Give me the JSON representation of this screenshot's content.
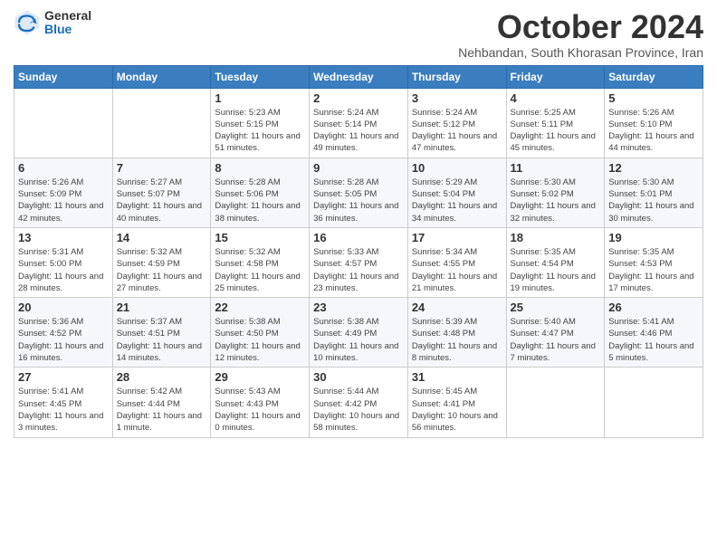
{
  "header": {
    "logo_general": "General",
    "logo_blue": "Blue",
    "month_title": "October 2024",
    "subtitle": "Nehbandan, South Khorasan Province, Iran"
  },
  "calendar": {
    "days_of_week": [
      "Sunday",
      "Monday",
      "Tuesday",
      "Wednesday",
      "Thursday",
      "Friday",
      "Saturday"
    ],
    "weeks": [
      [
        {
          "day": "",
          "info": ""
        },
        {
          "day": "",
          "info": ""
        },
        {
          "day": "1",
          "info": "Sunrise: 5:23 AM\nSunset: 5:15 PM\nDaylight: 11 hours and 51 minutes."
        },
        {
          "day": "2",
          "info": "Sunrise: 5:24 AM\nSunset: 5:14 PM\nDaylight: 11 hours and 49 minutes."
        },
        {
          "day": "3",
          "info": "Sunrise: 5:24 AM\nSunset: 5:12 PM\nDaylight: 11 hours and 47 minutes."
        },
        {
          "day": "4",
          "info": "Sunrise: 5:25 AM\nSunset: 5:11 PM\nDaylight: 11 hours and 45 minutes."
        },
        {
          "day": "5",
          "info": "Sunrise: 5:26 AM\nSunset: 5:10 PM\nDaylight: 11 hours and 44 minutes."
        }
      ],
      [
        {
          "day": "6",
          "info": "Sunrise: 5:26 AM\nSunset: 5:09 PM\nDaylight: 11 hours and 42 minutes."
        },
        {
          "day": "7",
          "info": "Sunrise: 5:27 AM\nSunset: 5:07 PM\nDaylight: 11 hours and 40 minutes."
        },
        {
          "day": "8",
          "info": "Sunrise: 5:28 AM\nSunset: 5:06 PM\nDaylight: 11 hours and 38 minutes."
        },
        {
          "day": "9",
          "info": "Sunrise: 5:28 AM\nSunset: 5:05 PM\nDaylight: 11 hours and 36 minutes."
        },
        {
          "day": "10",
          "info": "Sunrise: 5:29 AM\nSunset: 5:04 PM\nDaylight: 11 hours and 34 minutes."
        },
        {
          "day": "11",
          "info": "Sunrise: 5:30 AM\nSunset: 5:02 PM\nDaylight: 11 hours and 32 minutes."
        },
        {
          "day": "12",
          "info": "Sunrise: 5:30 AM\nSunset: 5:01 PM\nDaylight: 11 hours and 30 minutes."
        }
      ],
      [
        {
          "day": "13",
          "info": "Sunrise: 5:31 AM\nSunset: 5:00 PM\nDaylight: 11 hours and 28 minutes."
        },
        {
          "day": "14",
          "info": "Sunrise: 5:32 AM\nSunset: 4:59 PM\nDaylight: 11 hours and 27 minutes."
        },
        {
          "day": "15",
          "info": "Sunrise: 5:32 AM\nSunset: 4:58 PM\nDaylight: 11 hours and 25 minutes."
        },
        {
          "day": "16",
          "info": "Sunrise: 5:33 AM\nSunset: 4:57 PM\nDaylight: 11 hours and 23 minutes."
        },
        {
          "day": "17",
          "info": "Sunrise: 5:34 AM\nSunset: 4:55 PM\nDaylight: 11 hours and 21 minutes."
        },
        {
          "day": "18",
          "info": "Sunrise: 5:35 AM\nSunset: 4:54 PM\nDaylight: 11 hours and 19 minutes."
        },
        {
          "day": "19",
          "info": "Sunrise: 5:35 AM\nSunset: 4:53 PM\nDaylight: 11 hours and 17 minutes."
        }
      ],
      [
        {
          "day": "20",
          "info": "Sunrise: 5:36 AM\nSunset: 4:52 PM\nDaylight: 11 hours and 16 minutes."
        },
        {
          "day": "21",
          "info": "Sunrise: 5:37 AM\nSunset: 4:51 PM\nDaylight: 11 hours and 14 minutes."
        },
        {
          "day": "22",
          "info": "Sunrise: 5:38 AM\nSunset: 4:50 PM\nDaylight: 11 hours and 12 minutes."
        },
        {
          "day": "23",
          "info": "Sunrise: 5:38 AM\nSunset: 4:49 PM\nDaylight: 11 hours and 10 minutes."
        },
        {
          "day": "24",
          "info": "Sunrise: 5:39 AM\nSunset: 4:48 PM\nDaylight: 11 hours and 8 minutes."
        },
        {
          "day": "25",
          "info": "Sunrise: 5:40 AM\nSunset: 4:47 PM\nDaylight: 11 hours and 7 minutes."
        },
        {
          "day": "26",
          "info": "Sunrise: 5:41 AM\nSunset: 4:46 PM\nDaylight: 11 hours and 5 minutes."
        }
      ],
      [
        {
          "day": "27",
          "info": "Sunrise: 5:41 AM\nSunset: 4:45 PM\nDaylight: 11 hours and 3 minutes."
        },
        {
          "day": "28",
          "info": "Sunrise: 5:42 AM\nSunset: 4:44 PM\nDaylight: 11 hours and 1 minute."
        },
        {
          "day": "29",
          "info": "Sunrise: 5:43 AM\nSunset: 4:43 PM\nDaylight: 11 hours and 0 minutes."
        },
        {
          "day": "30",
          "info": "Sunrise: 5:44 AM\nSunset: 4:42 PM\nDaylight: 10 hours and 58 minutes."
        },
        {
          "day": "31",
          "info": "Sunrise: 5:45 AM\nSunset: 4:41 PM\nDaylight: 10 hours and 56 minutes."
        },
        {
          "day": "",
          "info": ""
        },
        {
          "day": "",
          "info": ""
        }
      ]
    ]
  }
}
